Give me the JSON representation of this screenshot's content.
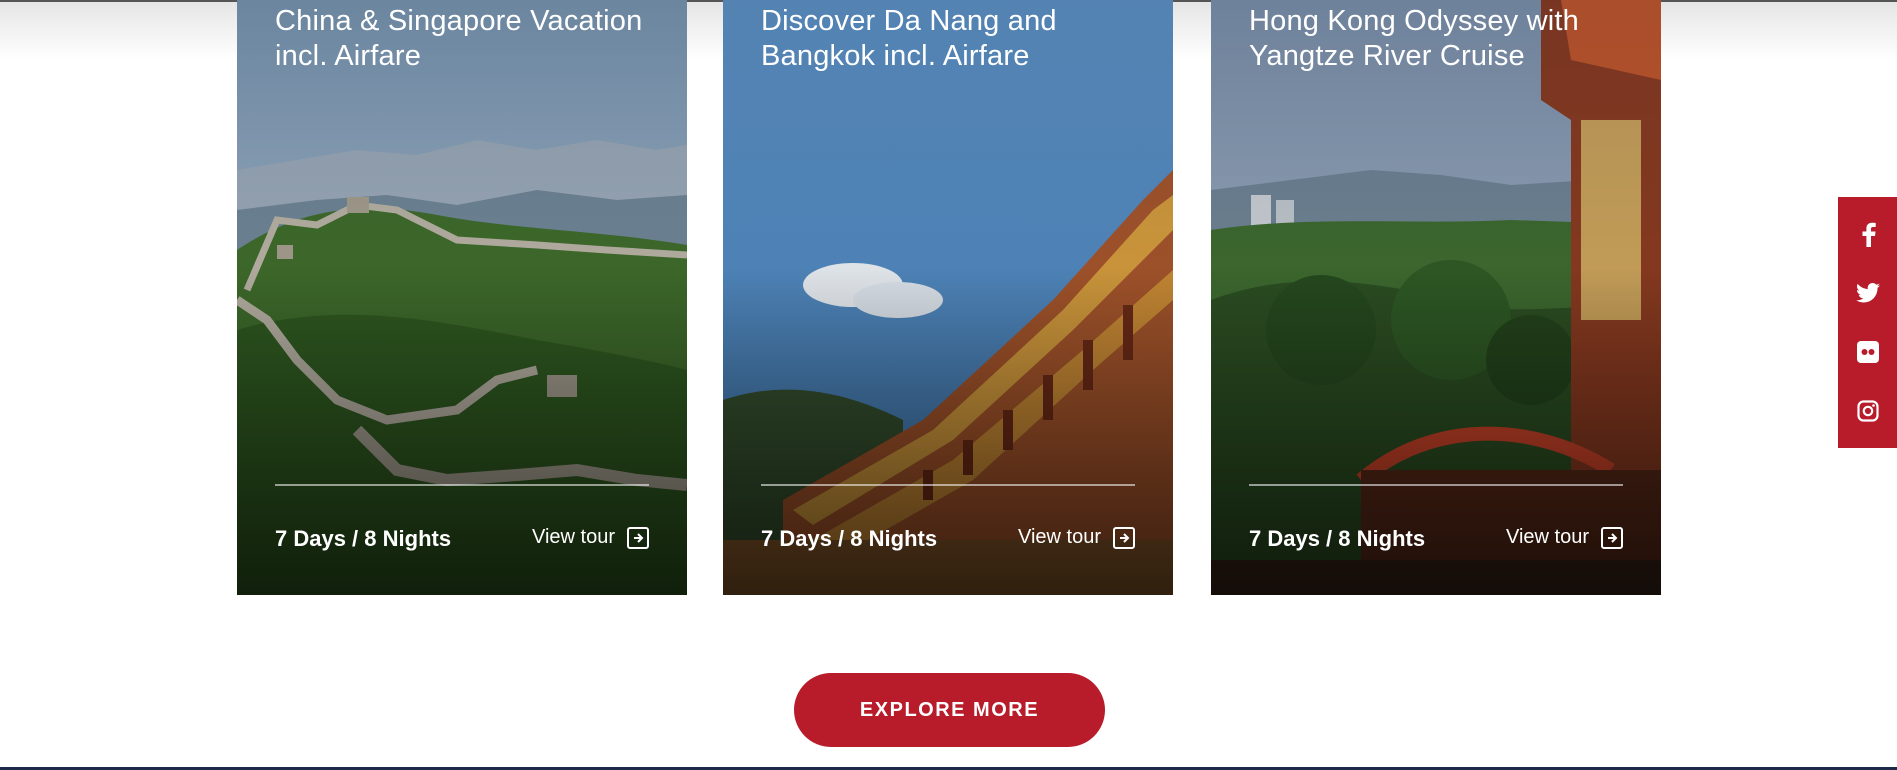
{
  "tours": [
    {
      "title": "China & Singapore Vacation incl. Airfare",
      "duration": "7 Days / 8 Nights",
      "cta": "View tour"
    },
    {
      "title": "Discover Da Nang and Bangkok incl. Airfare",
      "duration": "7 Days / 8 Nights",
      "cta": "View tour"
    },
    {
      "title": "Hong Kong Odyssey with Yangtze River Cruise",
      "duration": "7 Days / 8 Nights",
      "cta": "View tour"
    }
  ],
  "explore": {
    "label": "EXPLORE MORE"
  },
  "social": {
    "items": [
      "facebook-icon",
      "twitter-icon",
      "flickr-icon",
      "instagram-icon"
    ]
  },
  "colors": {
    "accent": "#b81c2b",
    "text_on_image": "#ffffff"
  }
}
